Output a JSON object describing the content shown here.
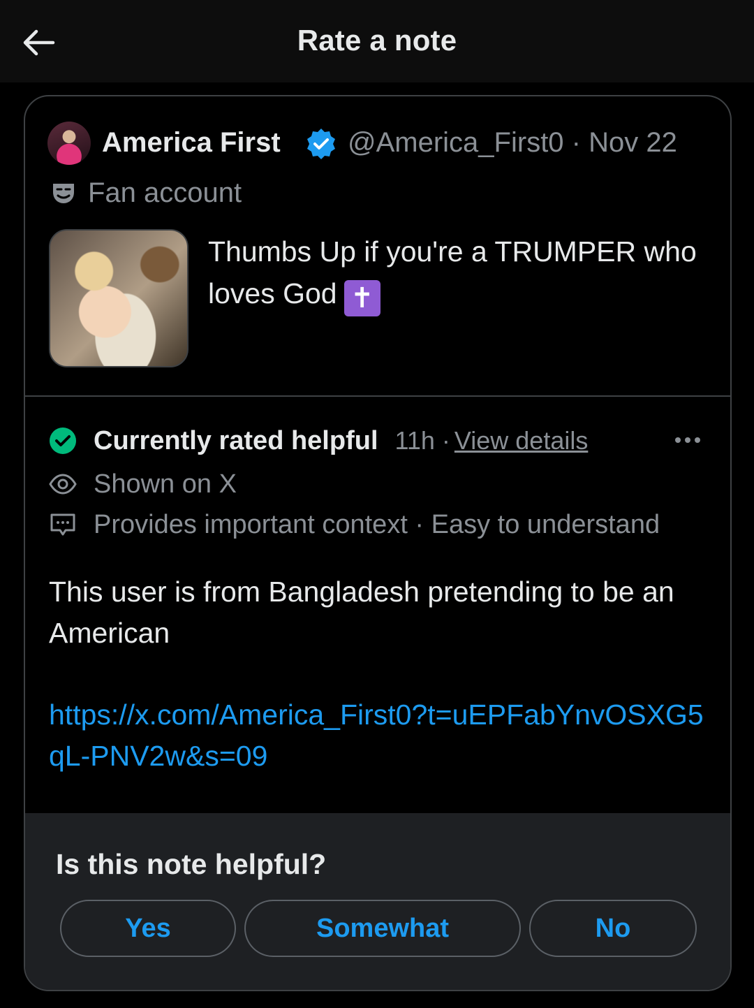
{
  "header": {
    "title": "Rate a note"
  },
  "post": {
    "author_name": "America First",
    "handle_date": "@America_First0 · Nov 22",
    "account_label": "Fan account",
    "text": "Thumbs Up if you're a TRUMPER who loves God",
    "emoji": "✝"
  },
  "note": {
    "status": "Currently rated helpful",
    "time": "11h ·",
    "view_details": "View details",
    "shown_on": "Shown on X",
    "reasons": "Provides important context · Easy to understand",
    "body": "This user is from Bangladesh pretending to be an American",
    "link": "https://x.com/America_First0?t=uEPFabYnvOSXG5qL-PNV2w&s=09"
  },
  "rating": {
    "question": "Is this note helpful?",
    "options": [
      "Yes",
      "Somewhat",
      "No"
    ]
  },
  "colors": {
    "link": "#1d9bf0",
    "helpful_green": "#00ba7c",
    "verified_blue": "#1d9bf0"
  }
}
